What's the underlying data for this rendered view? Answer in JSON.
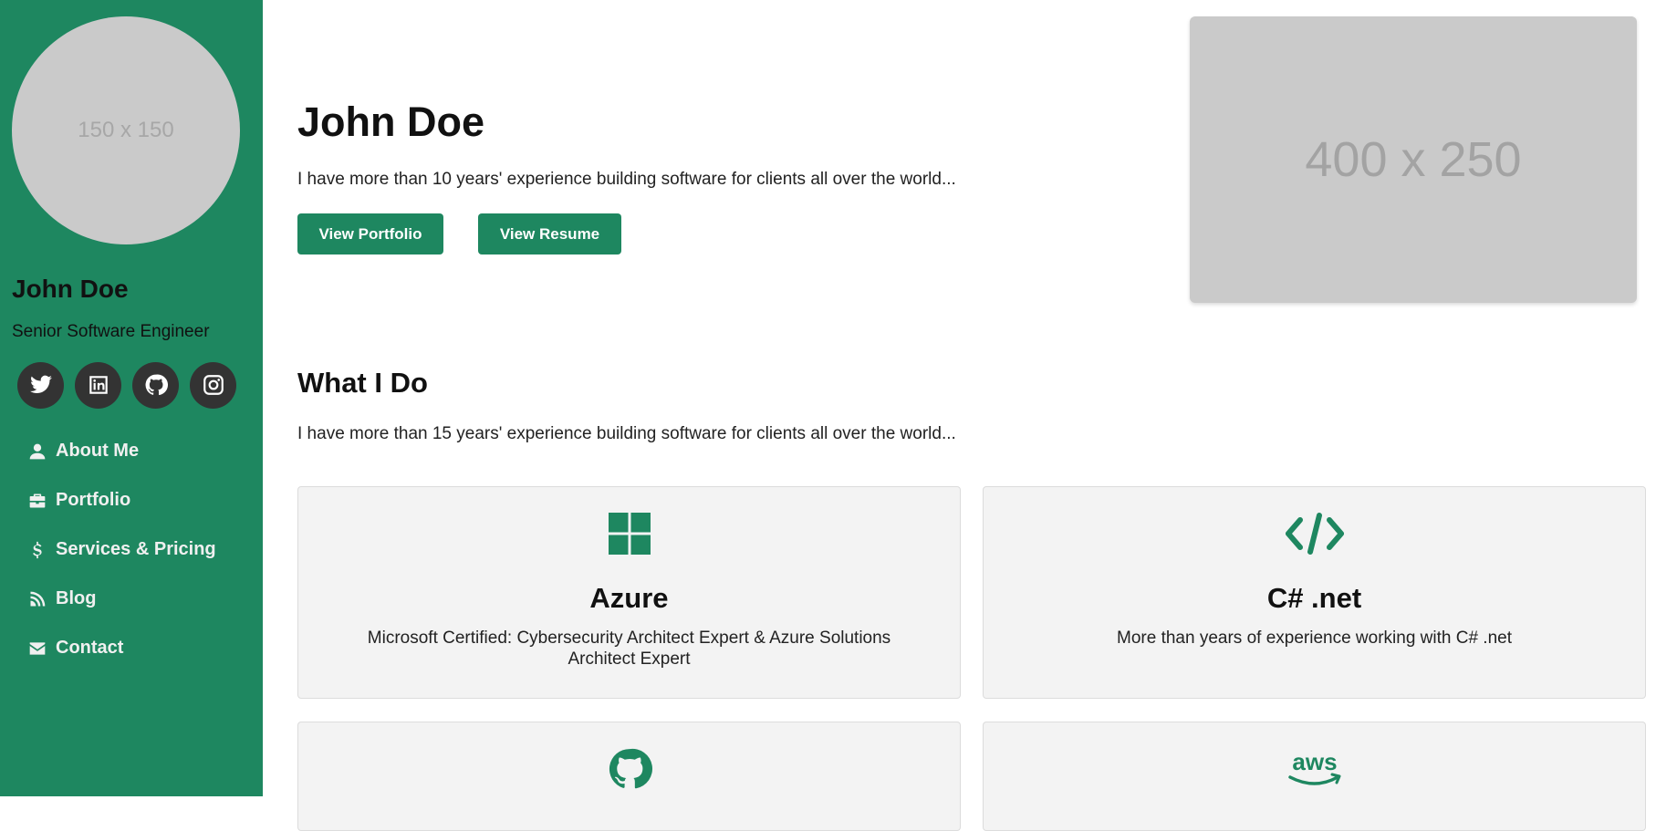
{
  "sidebar": {
    "avatar_placeholder": "150 x 150",
    "name": "John Doe",
    "title": "Senior Software Engineer",
    "socials": [
      {
        "icon": "twitter-icon"
      },
      {
        "icon": "linkedin-icon"
      },
      {
        "icon": "github-icon"
      },
      {
        "icon": "instagram-icon"
      }
    ],
    "nav": [
      {
        "label": "About Me",
        "icon": "user-icon"
      },
      {
        "label": "Portfolio",
        "icon": "briefcase-icon"
      },
      {
        "label": "Services & Pricing",
        "icon": "dollar-icon"
      },
      {
        "label": "Blog",
        "icon": "blog-icon"
      },
      {
        "label": "Contact",
        "icon": "envelope-icon"
      }
    ]
  },
  "hero": {
    "name": "John Doe",
    "text": "I have more than 10 years' experience building software for clients all over the world...",
    "buttons": {
      "portfolio": "View Portfolio",
      "resume": "View Resume"
    },
    "image_placeholder": "400 x 250"
  },
  "services": {
    "title": "What I Do",
    "text": "I have more than 15 years' experience building software for clients all over the world...",
    "cards": [
      {
        "icon": "windows-icon",
        "title": "Azure",
        "description": "Microsoft Certified: Cybersecurity Architect Expert & Azure Solutions Architect Expert"
      },
      {
        "icon": "code-icon",
        "title": "C# .net",
        "description": "More than years of experience working with C# .net"
      },
      {
        "icon": "github-icon",
        "title": "",
        "description": ""
      },
      {
        "icon": "aws-icon",
        "title": "",
        "description": ""
      }
    ]
  },
  "colors": {
    "accent": "#1e8760",
    "sidebar_bg": "#1e8760",
    "social_bg": "#333333",
    "placeholder_bg": "#cacaca",
    "card_bg": "#f3f3f3"
  }
}
